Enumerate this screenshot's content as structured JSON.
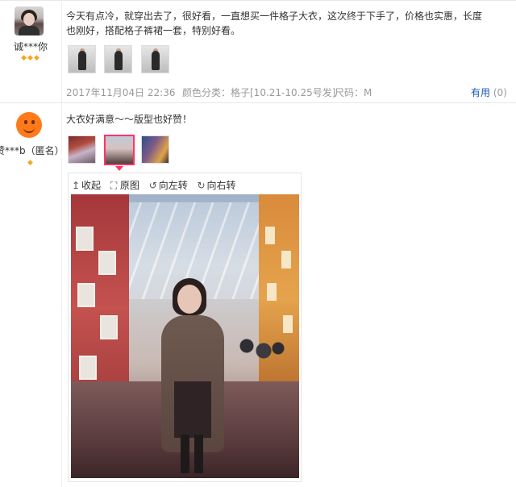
{
  "review1": {
    "username": "诚***你",
    "level_diamonds": "◆◆◆",
    "text_line1": "今天有点冷，就穿出去了，很好看，一直想买一件格子大衣，这次终于下手了，价格也实惠，长度",
    "text_line2": "也刚好，搭配格子裤裙一套，特别好看。",
    "date": "2017年11月04日 22:36",
    "color_class": "颜色分类：格子[10.21-10.25号发]",
    "size": "尺码：M",
    "useful_label": "有用",
    "useful_count": "(0)"
  },
  "review2": {
    "username": "赞***b（匿名）",
    "level_diamonds": "◆",
    "text": "大衣好满意～～版型也好赞！"
  },
  "viewer": {
    "collapse_label": "收起",
    "original_label": "原图",
    "rotate_left_label": "向左转",
    "rotate_right_label": "向右转",
    "collapse_icon": "arrow-up-icon",
    "original_icon": "expand-icon",
    "rotate_left_icon": "rotate-left-icon",
    "rotate_right_icon": "rotate-right-icon"
  },
  "colors": {
    "link_blue": "#1a58b3",
    "meta_gray": "#999999",
    "selected_border": "#ff3366",
    "diamond_gold": "#f5a623"
  }
}
